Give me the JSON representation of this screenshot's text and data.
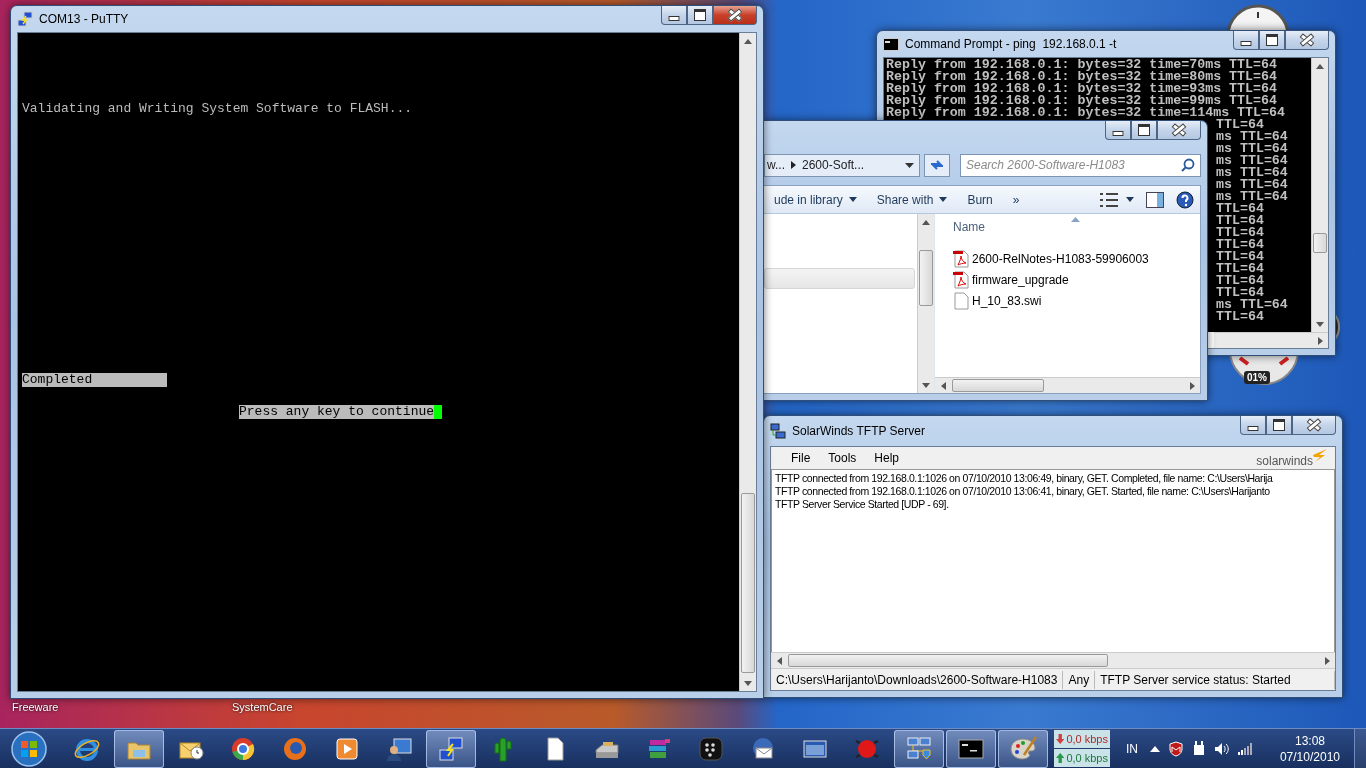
{
  "desktop": {
    "icon_labels": [
      "Freeware",
      "SystemCare"
    ]
  },
  "putty": {
    "title": "COM13 - PuTTY",
    "lines": [
      {
        "kind": "message",
        "text": "Validating and Writing System Software to FLASH..."
      },
      {
        "kind": "status",
        "text": "Completed"
      },
      {
        "kind": "prompt",
        "text": "Press any key to continue"
      }
    ]
  },
  "command_prompt": {
    "title": "Command Prompt - ping  192.168.0.1 -t",
    "lines": [
      {
        "kind": "full",
        "text": "Reply from 192.168.0.1: bytes=32 time=70ms TTL=64"
      },
      {
        "kind": "full",
        "text": "Reply from 192.168.0.1: bytes=32 time=80ms TTL=64"
      },
      {
        "kind": "full",
        "text": "Reply from 192.168.0.1: bytes=32 time=93ms TTL=64"
      },
      {
        "kind": "full",
        "text": "Reply from 192.168.0.1: bytes=32 time=99ms TTL=64"
      },
      {
        "kind": "full",
        "text": "Reply from 192.168.0.1: bytes=32 time=114ms TTL=64"
      },
      {
        "kind": "tail",
        "text": "TTL=64"
      },
      {
        "kind": "tail",
        "text": "ms TTL=64"
      },
      {
        "kind": "tail",
        "text": "ms TTL=64"
      },
      {
        "kind": "tail",
        "text": "ms TTL=64"
      },
      {
        "kind": "tail",
        "text": "ms TTL=64"
      },
      {
        "kind": "tail",
        "text": "ms TTL=64"
      },
      {
        "kind": "tail",
        "text": "ms TTL=64"
      },
      {
        "kind": "tail",
        "text": "TTL=64"
      },
      {
        "kind": "tail",
        "text": "TTL=64"
      },
      {
        "kind": "tail",
        "text": "TTL=64"
      },
      {
        "kind": "tail",
        "text": "TTL=64"
      },
      {
        "kind": "tail",
        "text": "TTL=64"
      },
      {
        "kind": "tail",
        "text": "TTL=64"
      },
      {
        "kind": "tail",
        "text": "TTL=64"
      },
      {
        "kind": "tail",
        "text": "TTL=64"
      },
      {
        "kind": "tail",
        "text": "ms TTL=64"
      },
      {
        "kind": "tail",
        "text": "TTL=64"
      }
    ]
  },
  "explorer": {
    "breadcrumbs": [
      "w...",
      "2600-Soft..."
    ],
    "search": {
      "placeholder": "Search 2600-Software-H1083"
    },
    "toolbar": [
      {
        "label": "ude in library",
        "menu": true
      },
      {
        "label": "Share with",
        "menu": true
      },
      {
        "label": "Burn",
        "menu": false
      },
      {
        "label": "»",
        "menu": false
      }
    ],
    "column": "Name",
    "files": [
      {
        "name": "2600-RelNotes-H1083-59906003",
        "kind": "pdf"
      },
      {
        "name": "firmware_upgrade",
        "kind": "pdf"
      },
      {
        "name": "H_10_83.swi",
        "kind": "file"
      }
    ]
  },
  "tftp": {
    "title": "SolarWinds TFTP Server",
    "menu": [
      "File",
      "Tools",
      "Help"
    ],
    "logo": "solarwinds",
    "log": [
      "TFTP connected from 192.168.0.1:1026 on 07/10/2010 13:06:49, binary, GET. Completed, file name: C:\\Users\\Harija",
      "TFTP connected from 192.168.0.1:1026 on 07/10/2010 13:06:41, binary, GET. Started, file name: C:\\Users\\Harijanto",
      "TFTP Server Service Started [UDP - 69]."
    ],
    "status_bar": [
      "C:\\Users\\Harijanto\\Downloads\\2600-Software-H1083",
      "Any",
      "TFTP Server service status: Started"
    ]
  },
  "gadgets": {
    "cpu_reading": "01%"
  },
  "taskbar": {
    "items": [
      {
        "kind": "e-browser",
        "open": false
      },
      {
        "kind": "folder",
        "open": true
      },
      {
        "kind": "mail-clock",
        "open": false
      },
      {
        "kind": "chrome",
        "open": false
      },
      {
        "kind": "firefox",
        "open": false
      },
      {
        "kind": "media-player",
        "open": false
      },
      {
        "kind": "person-monitor",
        "open": false
      },
      {
        "kind": "terminal-link",
        "open": true
      },
      {
        "kind": "cactus",
        "open": false
      },
      {
        "kind": "document",
        "open": false
      },
      {
        "kind": "scanner",
        "open": false
      },
      {
        "kind": "book-stack",
        "open": false
      },
      {
        "kind": "berry",
        "open": false
      },
      {
        "kind": "bird-mail",
        "open": false
      },
      {
        "kind": "app-window",
        "open": false
      },
      {
        "kind": "red-ball",
        "open": false
      },
      {
        "kind": "network",
        "open": true
      },
      {
        "kind": "console",
        "open": true
      },
      {
        "kind": "palette",
        "open": true
      }
    ],
    "network": [
      {
        "kind": "down",
        "text": "0,0 kbps"
      },
      {
        "kind": "up",
        "text": "0,0 kbps"
      }
    ],
    "language": "IN",
    "time": "13:08",
    "date": "07/10/2010"
  }
}
